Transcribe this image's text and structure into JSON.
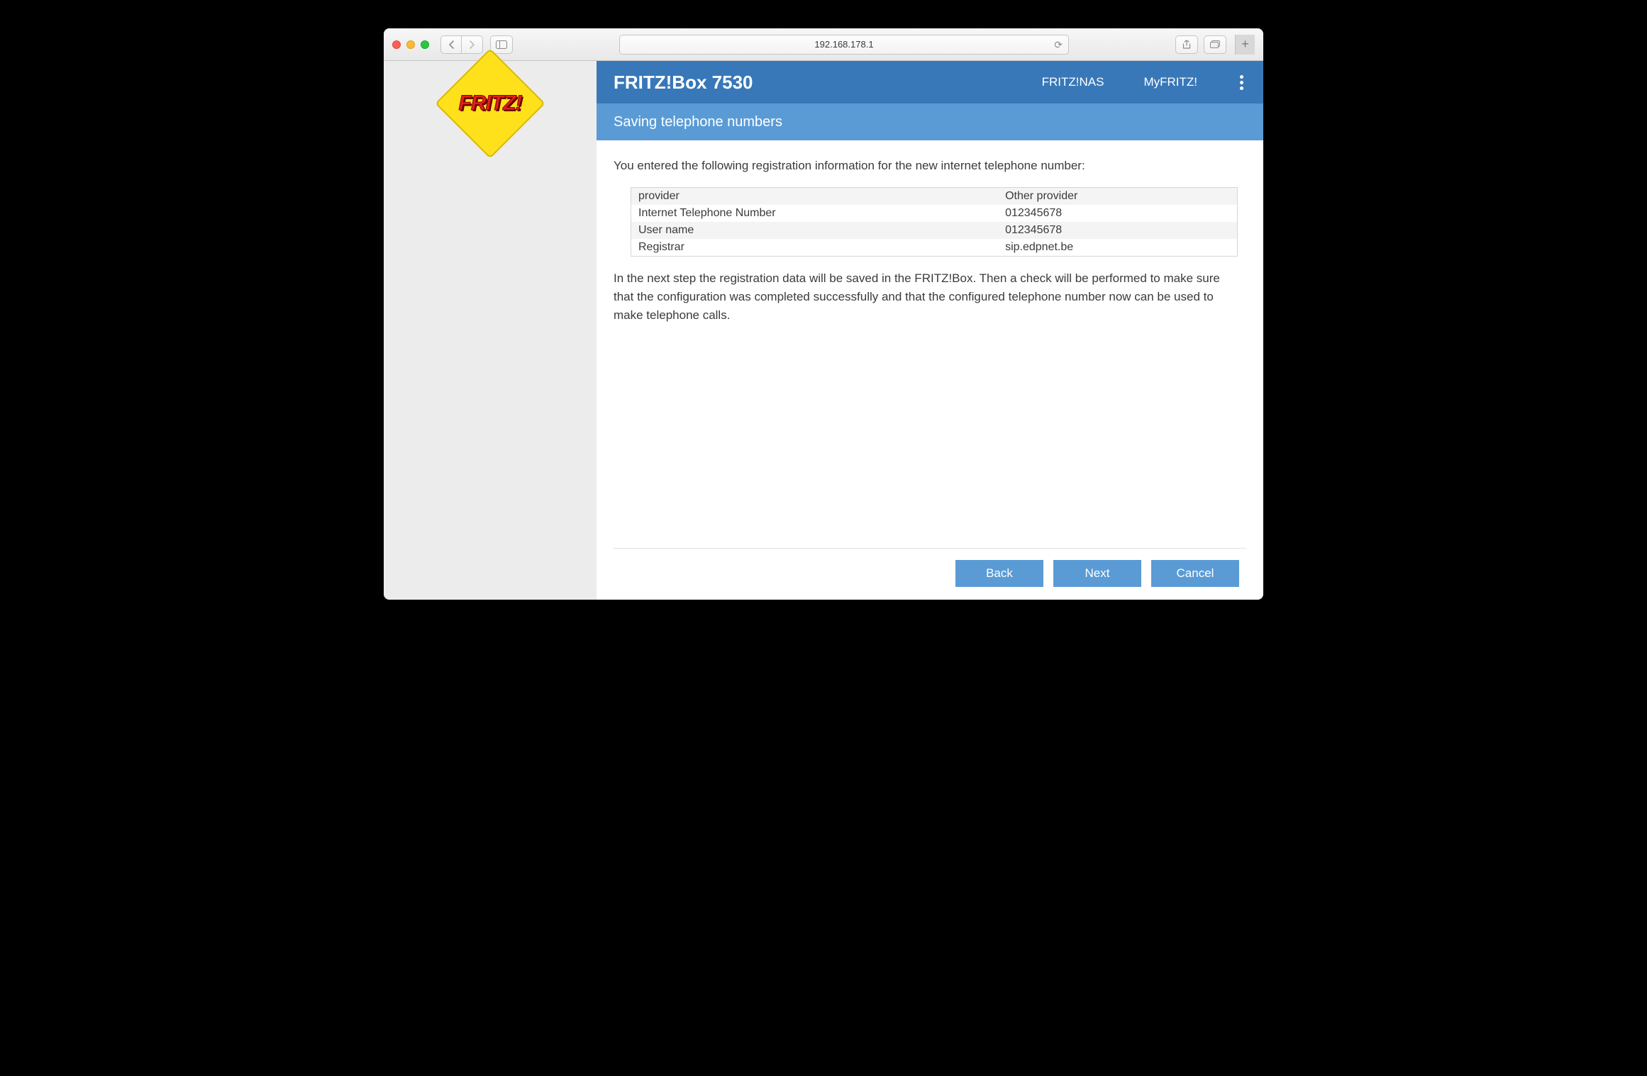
{
  "browser": {
    "url": "192.168.178.1"
  },
  "header": {
    "title": "FRITZ!Box 7530",
    "link_nas": "FRITZ!NAS",
    "link_myfritz": "MyFRITZ!"
  },
  "logo": {
    "text": "FRITZ!"
  },
  "subheader": {
    "title": "Saving telephone numbers"
  },
  "panel": {
    "intro": "You entered the following registration information for the new internet telephone number:",
    "rows": [
      {
        "k": "provider",
        "v": "Other provider"
      },
      {
        "k": "Internet Telephone Number",
        "v": "012345678"
      },
      {
        "k": "User name",
        "v": "012345678"
      },
      {
        "k": "Registrar",
        "v": "sip.edpnet.be"
      }
    ],
    "description": "In the next step the registration data will be saved in the FRITZ!Box. Then a check will be performed to make sure that the configuration was completed successfully and that the configured telephone number now can be used to make telephone calls."
  },
  "buttons": {
    "back": "Back",
    "next": "Next",
    "cancel": "Cancel"
  }
}
